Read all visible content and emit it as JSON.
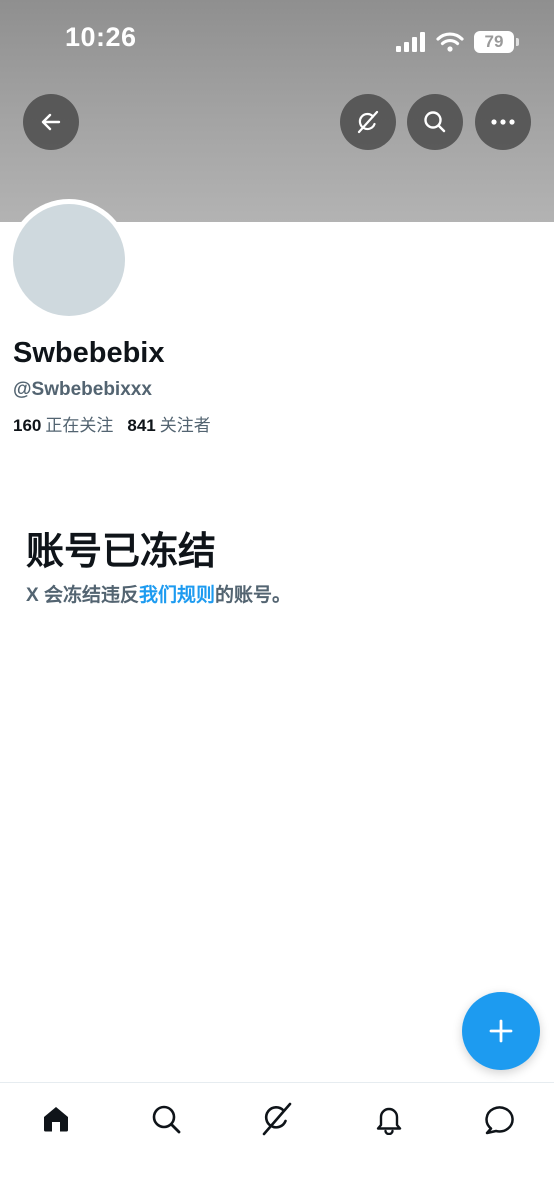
{
  "status_bar": {
    "time": "10:26",
    "battery": "79"
  },
  "top_actions": {
    "back_icon": "arrow-left-icon",
    "grok_icon": "grok-icon",
    "search_icon": "search-icon",
    "more_icon": "more-horizontal-icon"
  },
  "profile": {
    "display_name": "Swbebebix",
    "handle": "@Swbebebixxx",
    "following_count": "160",
    "following_label": "正在关注",
    "followers_count": "841",
    "followers_label": "关注者"
  },
  "suspended": {
    "title": "账号已冻结",
    "desc_prefix": "X 会冻结违反",
    "desc_link": "我们规则",
    "desc_suffix": "的账号。"
  },
  "fab": {
    "icon": "plus-icon"
  },
  "tab_bar": {
    "tabs": [
      "home-icon",
      "search-icon",
      "grok-icon",
      "bell-icon",
      "message-icon"
    ]
  },
  "colors": {
    "accent": "#1d9bf0",
    "secondary_text": "#536471",
    "primary_text": "#0f1419",
    "avatar_placeholder": "#cfd9de"
  }
}
